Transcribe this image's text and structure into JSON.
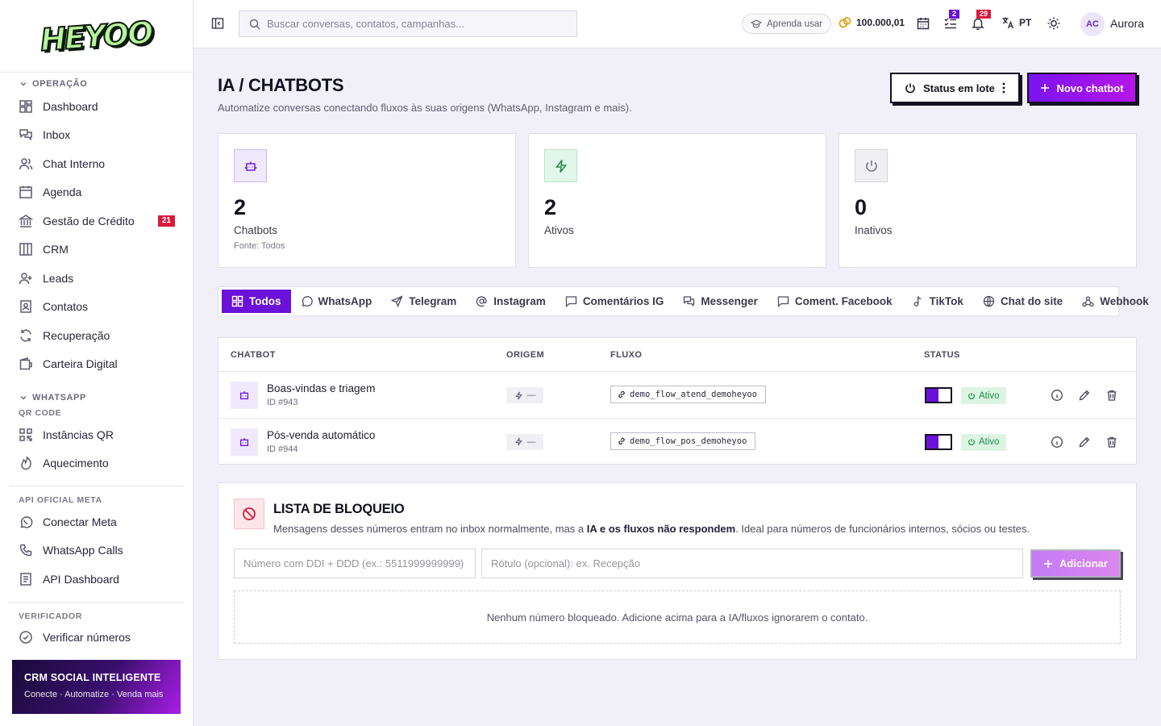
{
  "brand": {
    "logo_text": "HEYOO"
  },
  "sidebar": {
    "sections": {
      "operacao": "OPERAÇÃO",
      "whatsapp": "WHATSAPP",
      "qr_code": "QR CODE",
      "api_meta": "API OFICIAL META",
      "verificador": "VERIFICADOR"
    },
    "items": {
      "dashboard": "Dashboard",
      "inbox": "Inbox",
      "chat_interno": "Chat Interno",
      "agenda": "Agenda",
      "gestao_credito": "Gestão de Crédito",
      "gestao_credito_badge": "21",
      "crm": "CRM",
      "leads": "Leads",
      "contatos": "Contatos",
      "recuperacao": "Recuperação",
      "carteira": "Carteira Digital",
      "instancias_qr": "Instâncias QR",
      "aquecimento": "Aquecimento",
      "conectar_meta": "Conectar Meta",
      "whatsapp_calls": "WhatsApp Calls",
      "api_dashboard": "API Dashboard",
      "verificar_numeros": "Verificar números"
    },
    "promo": {
      "title": "CRM SOCIAL INTELIGENTE",
      "subtitle": "Conecte · Automatize · Venda mais"
    }
  },
  "topbar": {
    "search_placeholder": "Buscar conversas, contatos, campanhas...",
    "learn_label": "Aprenda usar",
    "credits": "100.000,01",
    "tasks_badge": "2",
    "notifications_badge": "29",
    "language": "PT",
    "user_initials": "AC",
    "user_name": "Aurora"
  },
  "page": {
    "title": "IA / CHATBOTS",
    "subtitle": "Automatize conversas conectando fluxos às suas origens (WhatsApp, Instagram e mais).",
    "batch_button": "Status em lote",
    "new_button": "Novo chatbot"
  },
  "stats": [
    {
      "value": "2",
      "label": "Chatbots",
      "note": "Fonte: Todos"
    },
    {
      "value": "2",
      "label": "Ativos"
    },
    {
      "value": "0",
      "label": "Inativos"
    }
  ],
  "tabs": [
    "Todos",
    "WhatsApp",
    "Telegram",
    "Instagram",
    "Comentários IG",
    "Messenger",
    "Coment. Facebook",
    "TikTok",
    "Chat do site",
    "Webhook"
  ],
  "table": {
    "headers": {
      "chatbot": "CHATBOT",
      "origem": "ORIGEM",
      "fluxo": "FLUXO",
      "status": "STATUS"
    },
    "rows": [
      {
        "name": "Boas-vindas e triagem",
        "id": "ID #943",
        "origin": "—",
        "flow": "demo_flow_atend_demoheyoo",
        "status": "Ativo",
        "enabled": true
      },
      {
        "name": "Pós-venda automático",
        "id": "ID #944",
        "origin": "—",
        "flow": "demo_flow_pos_demoheyoo",
        "status": "Ativo",
        "enabled": true
      }
    ]
  },
  "blocklist": {
    "title": "LISTA DE BLOQUEIO",
    "desc_pre": "Mensagens desses números entram no inbox normalmente, mas a ",
    "desc_bold": "IA e os fluxos não respondem",
    "desc_post": ". Ideal para números de funcionários internos, sócios ou testes.",
    "number_placeholder": "Número com DDI + DDD (ex.: 5511999999999)",
    "label_placeholder": "Rótulo (opcional): ex. Recepção",
    "add_button": "Adicionar",
    "empty_text": "Nenhum número bloqueado. Adicione acima para a IA/fluxos ignorarem o contato."
  },
  "colors": {
    "accent": "#6a12d9",
    "accent2": "#b615e8",
    "danger": "#d81b3c",
    "success": "#1f8a4b"
  }
}
